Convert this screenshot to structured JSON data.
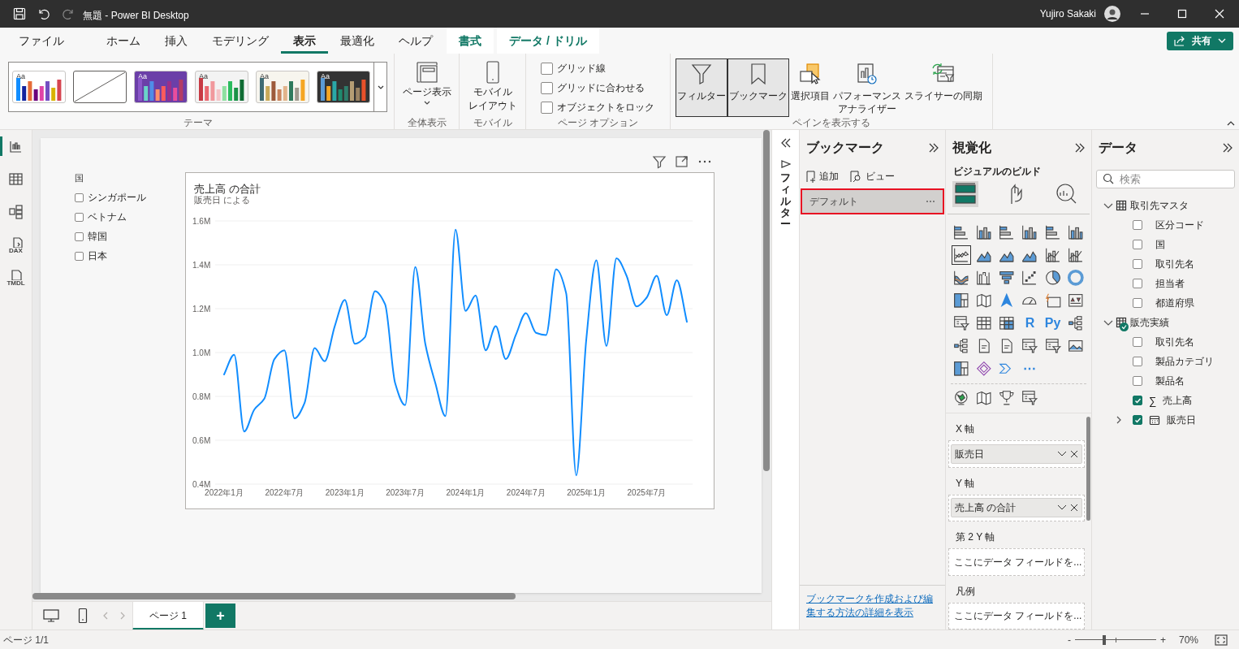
{
  "window": {
    "title": "無題 - Power BI Desktop",
    "user": "Yujiro Sakaki"
  },
  "menu_tabs": [
    {
      "label": "ファイル",
      "selected": false,
      "kind": "plain"
    },
    {
      "label": "ホーム",
      "selected": false,
      "kind": "plain"
    },
    {
      "label": "挿入",
      "selected": false,
      "kind": "plain"
    },
    {
      "label": "モデリング",
      "selected": false,
      "kind": "plain"
    },
    {
      "label": "表示",
      "selected": true,
      "kind": "plain"
    },
    {
      "label": "最適化",
      "selected": false,
      "kind": "plain"
    },
    {
      "label": "ヘルプ",
      "selected": false,
      "kind": "plain"
    },
    {
      "label": "書式",
      "selected": false,
      "kind": "context"
    },
    {
      "label": "データ / ドリル",
      "selected": false,
      "kind": "context"
    }
  ],
  "share_button": "共有",
  "ribbon": {
    "themes": {
      "label": "テーマ",
      "items": [
        {
          "kind": "swatch",
          "text": "Aa",
          "color": "#ffffff"
        },
        {
          "kind": "blank"
        },
        {
          "kind": "swatch",
          "text": "Aa",
          "color": "#6b3fa8"
        },
        {
          "kind": "swatch",
          "text": "Aa",
          "color": "#f3f3f3"
        },
        {
          "kind": "swatch",
          "text": "Aa",
          "color": "#f7f5ee"
        },
        {
          "kind": "swatch",
          "text": "Aa",
          "color": "#333333"
        }
      ]
    },
    "page_view": {
      "label": "全体表示",
      "button": "ページ表示"
    },
    "mobile": {
      "label": "モバイル",
      "button_lines": [
        "モバイル",
        "レイアウト"
      ]
    },
    "page_options": {
      "label": "ページ オプション",
      "checkboxes": [
        {
          "label": "グリッド線",
          "checked": false
        },
        {
          "label": "グリッドに合わせる",
          "checked": false
        },
        {
          "label": "オブジェクトをロック",
          "checked": false
        }
      ]
    },
    "panes": {
      "label": "ペインを表示する",
      "buttons": [
        {
          "kind": "filter",
          "lines": [
            "フィルター"
          ],
          "selected": true
        },
        {
          "kind": "bookmark",
          "lines": [
            "ブックマーク"
          ],
          "selected": true
        },
        {
          "kind": "selection",
          "lines": [
            "選択項目"
          ],
          "selected": false
        },
        {
          "kind": "performance",
          "lines": [
            "パフォーマンス",
            "アナライザー"
          ],
          "selected": false
        },
        {
          "kind": "sync",
          "lines": [
            "スライサーの同期"
          ],
          "selected": false
        }
      ]
    }
  },
  "left_rail": [
    {
      "kind": "report",
      "selected": true
    },
    {
      "kind": "table",
      "selected": false
    },
    {
      "kind": "model",
      "selected": false
    },
    {
      "kind": "dax",
      "text": "DAX",
      "selected": false
    },
    {
      "kind": "tmdl",
      "text": "TMDL",
      "selected": false
    }
  ],
  "slicer": {
    "title": "国",
    "items": [
      {
        "label": "シンガポール",
        "checked": false
      },
      {
        "label": "ベトナム",
        "checked": false
      },
      {
        "label": "韓国",
        "checked": false
      },
      {
        "label": "日本",
        "checked": false
      }
    ]
  },
  "visual": {
    "title": "売上高 の合計",
    "subtitle": "販売日 による",
    "chart_data": {
      "type": "line",
      "categories": [
        "2022年1月",
        null,
        null,
        null,
        null,
        null,
        "2022年7月",
        null,
        null,
        null,
        null,
        null,
        "2023年1月",
        null,
        null,
        null,
        null,
        null,
        "2023年7月",
        null,
        null,
        null,
        null,
        null,
        "2024年1月",
        null,
        null,
        null,
        null,
        null,
        "2024年7月",
        null,
        null,
        null,
        null,
        null,
        "2025年1月",
        null,
        null,
        null,
        null,
        null,
        "2025年7月",
        null,
        null,
        null,
        null
      ],
      "series": [
        {
          "color": "#118dff",
          "values": [
            0.9,
            0.99,
            0.64,
            0.74,
            0.79,
            0.97,
            1.01,
            0.7,
            0.77,
            1.02,
            0.96,
            1.12,
            1.24,
            1.04,
            1.07,
            1.28,
            1.22,
            0.86,
            0.76,
            1.39,
            1.04,
            0.86,
            0.71,
            1.56,
            1.19,
            1.26,
            1.01,
            1.12,
            0.97,
            1.08,
            1.18,
            1.09,
            1.08,
            1.38,
            1.27,
            0.44,
            1.06,
            1.42,
            1.03,
            1.43,
            1.35,
            1.21,
            1.25,
            1.35,
            1.17,
            1.33,
            1.14
          ]
        }
      ],
      "ylim": [
        0.4,
        1.6
      ],
      "grid": true,
      "yticks": [
        {
          "value": 0.4,
          "label": "0.4M"
        },
        {
          "value": 0.6,
          "label": "0.6M"
        },
        {
          "value": 0.8,
          "label": "0.8M"
        },
        {
          "value": 1.0,
          "label": "1.0M"
        },
        {
          "value": 1.2,
          "label": "1.2M"
        },
        {
          "value": 1.4,
          "label": "1.4M"
        },
        {
          "value": 1.6,
          "label": "1.6M"
        }
      ]
    }
  },
  "page_tabs": [
    {
      "label": "ページ 1",
      "selected": true
    }
  ],
  "add_page": "+",
  "filter_pane": {
    "title": "フィルター"
  },
  "bookmarks": {
    "title": "ブックマーク",
    "add": "追加",
    "view": "ビュー",
    "items": [
      {
        "label": "デフォルト",
        "selected": true
      }
    ],
    "help_link": "ブックマークを作成および編集する方法の詳細を表示"
  },
  "visualizations": {
    "title": "視覚化",
    "subtitle": "ビジュアルのビルド",
    "tabs": [
      {
        "kind": "build",
        "selected": true
      },
      {
        "kind": "format",
        "selected": false
      },
      {
        "kind": "analytics",
        "selected": false
      }
    ],
    "icons": [
      {
        "kind": "bar",
        "selected": false
      },
      {
        "kind": "column",
        "selected": false
      },
      {
        "kind": "bar",
        "selected": false
      },
      {
        "kind": "column",
        "selected": false
      },
      {
        "kind": "bar",
        "selected": false
      },
      {
        "kind": "column",
        "selected": false
      },
      {
        "kind": "line",
        "selected": true
      },
      {
        "kind": "area",
        "selected": false
      },
      {
        "kind": "area",
        "selected": false
      },
      {
        "kind": "area",
        "selected": false
      },
      {
        "kind": "combo",
        "selected": false
      },
      {
        "kind": "combo",
        "selected": false
      },
      {
        "kind": "ribbon",
        "selected": false
      },
      {
        "kind": "waterfall",
        "selected": false
      },
      {
        "kind": "funnel",
        "selected": false
      },
      {
        "kind": "scatter",
        "selected": false
      },
      {
        "kind": "pie",
        "selected": false
      },
      {
        "kind": "donut",
        "selected": false
      },
      {
        "kind": "treemap",
        "selected": false
      },
      {
        "kind": "map",
        "selected": false
      },
      {
        "kind": "arrow",
        "selected": false
      },
      {
        "kind": "gauge",
        "selected": false
      },
      {
        "kind": "card",
        "selected": false
      },
      {
        "kind": "kpi",
        "selected": false
      },
      {
        "kind": "slicer",
        "selected": false
      },
      {
        "kind": "table",
        "selected": false
      },
      {
        "kind": "matrix",
        "selected": false
      },
      {
        "kind": "text",
        "text": "R",
        "selected": false
      },
      {
        "kind": "text",
        "text": "Py",
        "selected": false
      },
      {
        "kind": "tree",
        "selected": false
      },
      {
        "kind": "tree",
        "selected": false
      },
      {
        "kind": "document",
        "selected": false
      },
      {
        "kind": "document",
        "selected": false
      },
      {
        "kind": "slicer",
        "selected": false
      },
      {
        "kind": "slicer",
        "selected": false
      },
      {
        "kind": "image",
        "selected": false
      },
      {
        "kind": "treemap",
        "selected": false
      },
      {
        "kind": "diamond",
        "selected": false
      },
      {
        "kind": "chevron",
        "selected": false
      },
      {
        "kind": "text",
        "text": "⋯",
        "selected": false
      }
    ],
    "custom_icons": [
      {
        "kind": "globe"
      },
      {
        "kind": "map"
      },
      {
        "kind": "trophy"
      },
      {
        "kind": "slicer"
      }
    ],
    "wells": [
      {
        "label": "X 軸",
        "field": "販売日"
      },
      {
        "label": "Y 軸",
        "field": "売上高 の合計"
      },
      {
        "label": "第 2 Y 軸",
        "placeholder": "ここにデータ フィールドを..."
      },
      {
        "label": "凡例",
        "placeholder": "ここにデータ フィールドを..."
      }
    ]
  },
  "data_pane": {
    "title": "データ",
    "search_placeholder": "検索",
    "tables": [
      {
        "name": "取引先マスタ",
        "expanded": true,
        "in_use": false,
        "fields": [
          {
            "name": "区分コード",
            "checked": false,
            "kind": "text"
          },
          {
            "name": "国",
            "checked": false,
            "kind": "text"
          },
          {
            "name": "取引先名",
            "checked": false,
            "kind": "text"
          },
          {
            "name": "担当者",
            "checked": false,
            "kind": "text"
          },
          {
            "name": "都道府県",
            "checked": false,
            "kind": "text"
          }
        ]
      },
      {
        "name": "販売実績",
        "expanded": true,
        "in_use": true,
        "fields": [
          {
            "name": "取引先名",
            "checked": false,
            "kind": "text"
          },
          {
            "name": "製品カテゴリ",
            "checked": false,
            "kind": "text"
          },
          {
            "name": "製品名",
            "checked": false,
            "kind": "text"
          },
          {
            "name": "売上高",
            "checked": true,
            "kind": "sum",
            "symbol": "∑"
          },
          {
            "name": "販売日",
            "checked": true,
            "kind": "date",
            "expanded": false
          }
        ]
      }
    ]
  },
  "status_bar": {
    "page": "ページ 1/1",
    "zoom_minus": "-",
    "zoom_plus": "+",
    "zoom": "70%",
    "zoom_slider": {
      "level": 0.35
    }
  }
}
